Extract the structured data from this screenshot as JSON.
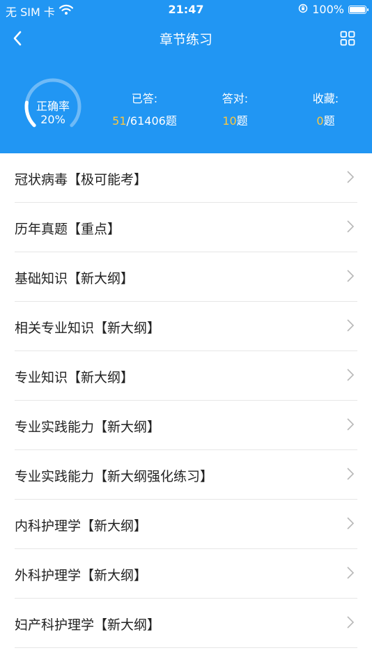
{
  "status_bar": {
    "carrier": "无 SIM 卡",
    "time": "21:47",
    "battery_text": "100%",
    "battery_level": 1.0
  },
  "nav": {
    "title": "章节练习",
    "back_icon": "chevron-left-icon",
    "grid_icon": "grid-icon"
  },
  "stats": {
    "accuracy_label": "正确率",
    "accuracy_value": "20%",
    "accuracy_fraction": 0.2,
    "answered_label": "已答:",
    "answered_count": "51",
    "answered_total": "/61406题",
    "correct_label": "答对:",
    "correct_count": "10",
    "correct_unit": "题",
    "fav_label": "收藏:",
    "fav_count": "0",
    "fav_unit": "题",
    "highlight_color": "#FFC83D",
    "header_color": "#2196F3"
  },
  "chapters": [
    {
      "label": "冠状病毒【极可能考】"
    },
    {
      "label": "历年真题【重点】"
    },
    {
      "label": "基础知识【新大纲】"
    },
    {
      "label": "相关专业知识【新大纲】"
    },
    {
      "label": "专业知识【新大纲】"
    },
    {
      "label": "专业实践能力【新大纲】"
    },
    {
      "label": "专业实践能力【新大纲强化练习】"
    },
    {
      "label": "内科护理学【新大纲】"
    },
    {
      "label": "外科护理学【新大纲】"
    },
    {
      "label": "妇产科护理学【新大纲】"
    }
  ]
}
